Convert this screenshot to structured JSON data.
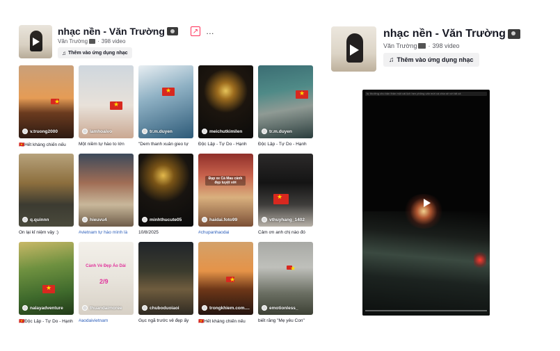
{
  "playlist": {
    "title": "nhạc nền - Văn Trường",
    "author": "Văn Trường",
    "video_count": "398 video",
    "add_button_label": "Thêm vào ứng dụng nhạc",
    "share_icon": "share-icon",
    "more_icon": "…"
  },
  "videos": [
    {
      "user": "v.truong2000",
      "caption": "🇻🇳Hết kháng chiến nếu"
    },
    {
      "user": "lamhoaivo",
      "caption": "Một niềm tự hào to lớn"
    },
    {
      "user": "tr.m.duyen",
      "caption": "\"Dem thanh xuân gieo tự"
    },
    {
      "user": "meichutkimilen",
      "caption": "Độc Lập - Tự Do - Hạnh"
    },
    {
      "user": "tr.m.duyen",
      "caption": "Độc Lập - Tự Do - Hạnh"
    },
    {
      "user": "q.quinnn",
      "caption": "Ôn lại kỉ niệm vậy :)"
    },
    {
      "user": "hieuvu4",
      "caption": "#vietnam tự hào mình là"
    },
    {
      "user": "minhthucute05",
      "caption": "10/8/2025"
    },
    {
      "user": "haidai.foto99",
      "caption": "#chupanhaodai"
    },
    {
      "user": "vthuyhang_1402",
      "caption": "Cảm ơn anh chị nào đó"
    },
    {
      "user": "nalayadventure",
      "caption": "🇻🇳Độc Lập - Tự Do - Hạnh"
    },
    {
      "user": "thuandaimoree",
      "caption": "#aodaivietnam"
    },
    {
      "user": "chuboduoiaoi",
      "caption": "Gục ngã trước vẻ đẹp ấy"
    },
    {
      "user": "trongkhiem.com....",
      "caption": "🇻🇳Hết kháng chiến nếu"
    },
    {
      "user": "emotionless_",
      "caption": "biết rằng \"Mẹ yêu Con\""
    }
  ],
  "overlays": {
    "market_text": "Đạp xe Cà Mau cảnh đẹp tuyệt vời",
    "aodai_text1": "Cảnh Vẻ Đẹp Áo Dài",
    "aodai_text2": "2/9"
  },
  "player": {
    "topbar_text": "tự thưởng cho bản thân một cái lịch hẹn phỏng vấn mới và chia sẻ với tất cả"
  }
}
